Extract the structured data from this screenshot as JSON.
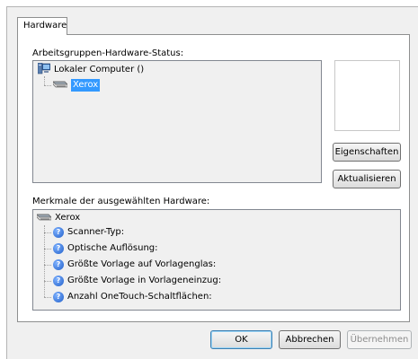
{
  "tab": {
    "label": "Hardware"
  },
  "status_group": {
    "label": "Arbeitsgruppen-Hardware-Status:",
    "computer": {
      "label": "Lokaler Computer ()",
      "icon": "computer-icon"
    },
    "device": {
      "label": "Xerox",
      "icon": "scanner-icon",
      "selected": true
    }
  },
  "buttons": {
    "properties": "Eigenschaften",
    "refresh": "Aktualisieren",
    "ok": "OK",
    "cancel": "Abbrechen",
    "apply": "Übernehmen"
  },
  "features_group": {
    "label": "Merkmale der ausgewählten Hardware:",
    "device": {
      "label": "Xerox",
      "icon": "scanner-icon"
    },
    "items": [
      {
        "label": "Scanner-Typ:",
        "icon": "help-icon"
      },
      {
        "label": "Optische Auflösung:",
        "icon": "help-icon"
      },
      {
        "label": "Größte Vorlage auf Vorlagenglas:",
        "icon": "help-icon"
      },
      {
        "label": "Größte Vorlage in Vorlageneinzug:",
        "icon": "help-icon"
      },
      {
        "label": "Anzahl OneTouch-Schaltflächen:",
        "icon": "help-icon"
      }
    ]
  },
  "colors": {
    "selection": "#3399ff",
    "dialog_bg": "#f0f0f0"
  }
}
